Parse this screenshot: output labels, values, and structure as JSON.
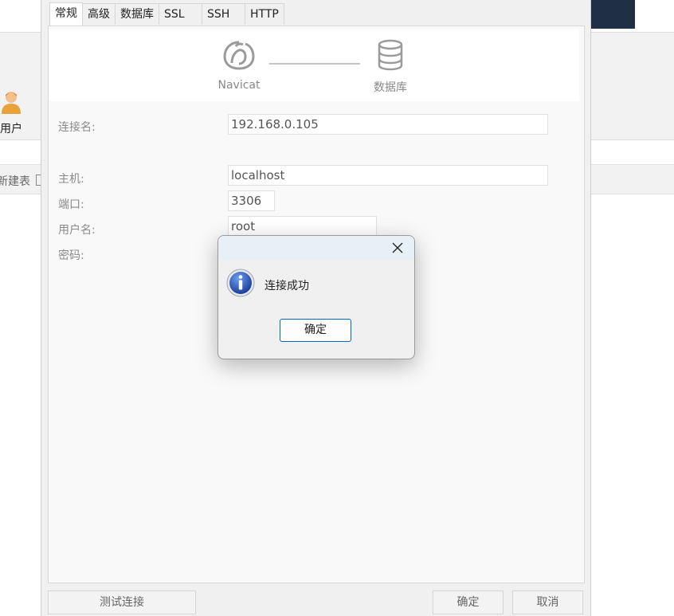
{
  "background_app": {
    "user_label": "用户",
    "subbar_label": "新建表"
  },
  "dialog": {
    "tabs": [
      {
        "label": "常规",
        "active": true
      },
      {
        "label": "高级",
        "active": false
      },
      {
        "label": "数据库",
        "active": false
      },
      {
        "label": "SSL",
        "active": false
      },
      {
        "label": "SSH",
        "active": false
      },
      {
        "label": "HTTP",
        "active": false
      }
    ],
    "header": {
      "left_label": "Navicat",
      "right_label": "数据库",
      "left_icon": "navicat-logo-icon",
      "right_icon": "database-icon"
    },
    "form": {
      "connection_name_label": "连接名:",
      "connection_name_value": "192.168.0.105",
      "host_label": "主机:",
      "host_value": "localhost",
      "port_label": "端口:",
      "port_value": "3306",
      "username_label": "用户名:",
      "username_value": "root",
      "password_label": "密码:"
    },
    "footer": {
      "test_button": "测试连接",
      "ok_button": "确定",
      "cancel_button": "取消"
    }
  },
  "message_box": {
    "message": "连接成功",
    "ok_button": "确定",
    "icon": "info-icon",
    "close_icon": "close-icon"
  },
  "colors": {
    "accent": "#0067c0",
    "info_icon": "#1a4aa8"
  }
}
